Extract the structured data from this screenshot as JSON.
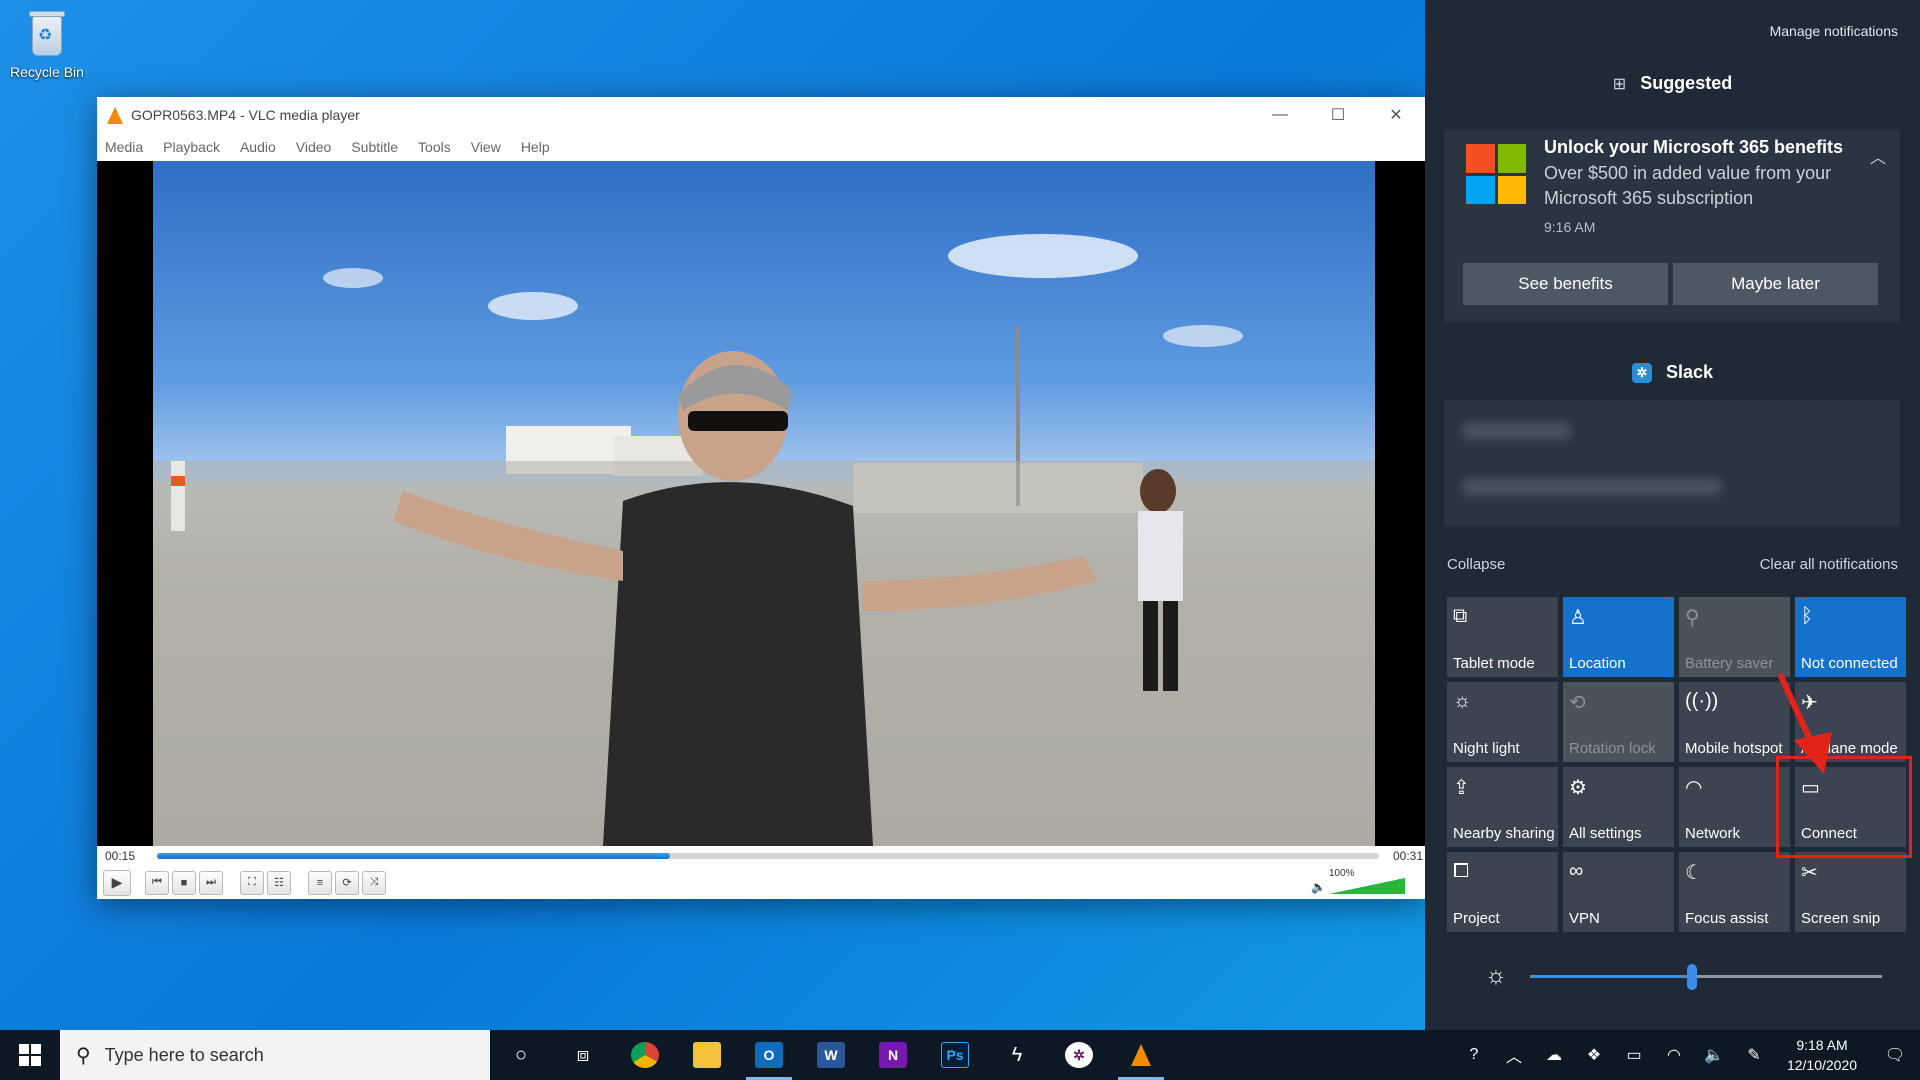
{
  "desktop": {
    "recycle_bin_label": "Recycle Bin"
  },
  "vlc": {
    "title": "GOPR0563.MP4 - VLC media player",
    "menu": [
      "Media",
      "Playback",
      "Audio",
      "Video",
      "Subtitle",
      "Tools",
      "View",
      "Help"
    ],
    "elapsed": "00:15",
    "total": "00:31",
    "progress_fraction": 0.42,
    "volume_label": "100%",
    "volume_fraction": 1.0
  },
  "action_center": {
    "manage_notifications": "Manage notifications",
    "suggested_header": "Suggested",
    "ms_card": {
      "title": "Unlock your Microsoft 365 benefits",
      "body": "Over $500 in added value from your Microsoft 365 subscription",
      "time": "9:16 AM",
      "btn_primary": "See benefits",
      "btn_secondary": "Maybe later"
    },
    "slack_header": "Slack",
    "collapse": "Collapse",
    "clear_all": "Clear all notifications",
    "tiles": [
      {
        "label": "Tablet mode",
        "icon": "tablet-icon",
        "state": "off"
      },
      {
        "label": "Location",
        "icon": "location-icon",
        "state": "on"
      },
      {
        "label": "Battery saver",
        "icon": "battery-saver-icon",
        "state": "disabled"
      },
      {
        "label": "Not connected",
        "icon": "bluetooth-icon",
        "state": "on"
      },
      {
        "label": "Night light",
        "icon": "night-light-icon",
        "state": "off"
      },
      {
        "label": "Rotation lock",
        "icon": "rotation-lock-icon",
        "state": "disabled"
      },
      {
        "label": "Mobile hotspot",
        "icon": "mobile-hotspot-icon",
        "state": "off"
      },
      {
        "label": "Airplane mode",
        "icon": "airplane-icon",
        "state": "off"
      },
      {
        "label": "Nearby sharing",
        "icon": "nearby-sharing-icon",
        "state": "off"
      },
      {
        "label": "All settings",
        "icon": "gear-icon",
        "state": "off"
      },
      {
        "label": "Network",
        "icon": "network-icon",
        "state": "off"
      },
      {
        "label": "Connect",
        "icon": "connect-icon",
        "state": "off"
      },
      {
        "label": "Project",
        "icon": "project-icon",
        "state": "off"
      },
      {
        "label": "VPN",
        "icon": "vpn-icon",
        "state": "off"
      },
      {
        "label": "Focus assist",
        "icon": "moon-icon",
        "state": "off"
      },
      {
        "label": "Screen snip",
        "icon": "screen-snip-icon",
        "state": "off"
      }
    ],
    "brightness_fraction": 0.46
  },
  "taskbar": {
    "search_placeholder": "Type here to search",
    "time": "9:18 AM",
    "date": "12/10/2020"
  },
  "colors": {
    "accent": "#1572cc",
    "tile_off": "#3b4450",
    "panel_bg": "#1f2a36",
    "highlight": "#e2231a"
  }
}
